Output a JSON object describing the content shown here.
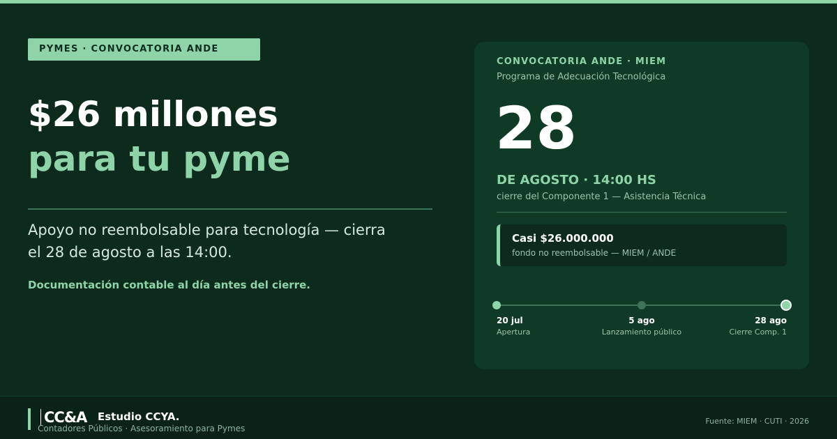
{
  "badge": "PYMES · CONVOCATORIA ANDE",
  "headline": {
    "line1": "$26 millones",
    "line2": "para tu pyme"
  },
  "description": "Apoyo no reembolsable para tecnología — cierra el 28 de agosto a las 14:00.",
  "note": "Documentación contable al día antes del cierre.",
  "card": {
    "kicker": "CONVOCATORIA ANDE · MIEM",
    "subtitle": "Programa de Adecuación Tecnológica",
    "day": "28",
    "time": "DE AGOSTO · 14:00 HS",
    "deadline_desc": "cierre del Componente 1 — Asistencia Técnica",
    "fund": {
      "amount": "Casi $26.000.000",
      "desc": "fondo no reembolsable — MIEM / ANDE"
    },
    "timeline": [
      {
        "date": "20 jul",
        "label": "Apertura"
      },
      {
        "date": "5 ago",
        "label": "Lanzamiento público"
      },
      {
        "date": "28 ago",
        "label": "Cierre Comp. 1"
      }
    ]
  },
  "footer": {
    "logo": "CC&A",
    "studio": "Estudio CCYA.",
    "tagline": "Contadores Públicos · Asesoramiento para Pymes",
    "source": "Fuente: MIEM · CUTI · 2026"
  },
  "colors": {
    "background": "#0c2b1d",
    "accent": "#8fd4a8",
    "card": "#0f3a26",
    "footer": "#0a2316"
  }
}
